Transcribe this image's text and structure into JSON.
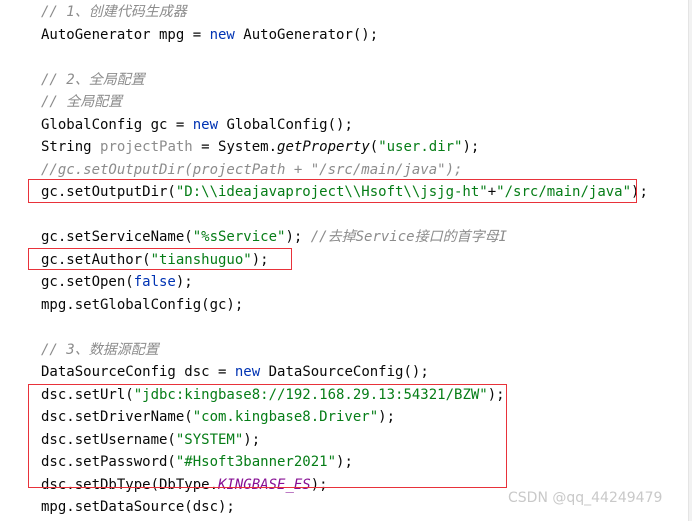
{
  "code": {
    "l1_comment": "// 1、创建代码生成器",
    "l2_type": "AutoGenerator mpg = ",
    "l2_new": "new",
    "l2_rest": " AutoGenerator();",
    "l4_comment": "// 2、全局配置",
    "l5_comment": "// 全局配置",
    "l6_type": "GlobalConfig gc = ",
    "l6_new": "new",
    "l6_rest": " GlobalConfig();",
    "l7_a": "String ",
    "l7_var": "projectPath",
    "l7_b": " = System.",
    "l7_method": "getProperty",
    "l7_c": "(",
    "l7_str": "\"user.dir\"",
    "l7_d": ");",
    "l8_comment": "//gc.setOutputDir(projectPath + \"/src/main/java\");",
    "l9_a": "gc.setOutputDir(",
    "l9_str1": "\"D:\\\\ideajavaproject\\\\Hsoft\\\\jsjg-ht\"",
    "l9_b": "+",
    "l9_str2": "\"/src/main/java\"",
    "l9_c": ");",
    "l11_a": "gc.setServiceName(",
    "l11_str": "\"%sService\"",
    "l11_b": "); ",
    "l11_comment": "//去掉Service接口的首字母I",
    "l12_a": "gc.setAuthor(",
    "l12_str": "\"tianshuguo\"",
    "l12_b": ");",
    "l13_a": "gc.setOpen(",
    "l13_kw": "false",
    "l13_b": ");",
    "l14": "mpg.setGlobalConfig(gc);",
    "l16_comment": "// 3、数据源配置",
    "l17_type": "DataSourceConfig dsc = ",
    "l17_new": "new",
    "l17_rest": " DataSourceConfig();",
    "l18_a": "dsc.setUrl(",
    "l18_str": "\"jdbc:kingbase8://192.168.29.13:54321/BZW\"",
    "l18_b": ");",
    "l19_a": "dsc.setDriverName(",
    "l19_str": "\"com.kingbase8.Driver\"",
    "l19_b": ");",
    "l20_a": "dsc.setUsername(",
    "l20_str": "\"SYSTEM\"",
    "l20_b": ");",
    "l21_a": "dsc.setPassword(",
    "l21_str": "\"#Hsoft3banner2021\"",
    "l21_b": ");",
    "l22_a": "dsc.setDbType(DbType.",
    "l22_const": "KINGBASE_ES",
    "l22_b": ");",
    "l23": "mpg.setDataSource(dsc);"
  },
  "watermark": "CSDN @qq_44249479",
  "colors": {
    "keyword": "#0033b3",
    "string": "#067d17",
    "comment": "#8c8c8c",
    "constant": "#871094",
    "highlight_box": "#e8323a"
  }
}
